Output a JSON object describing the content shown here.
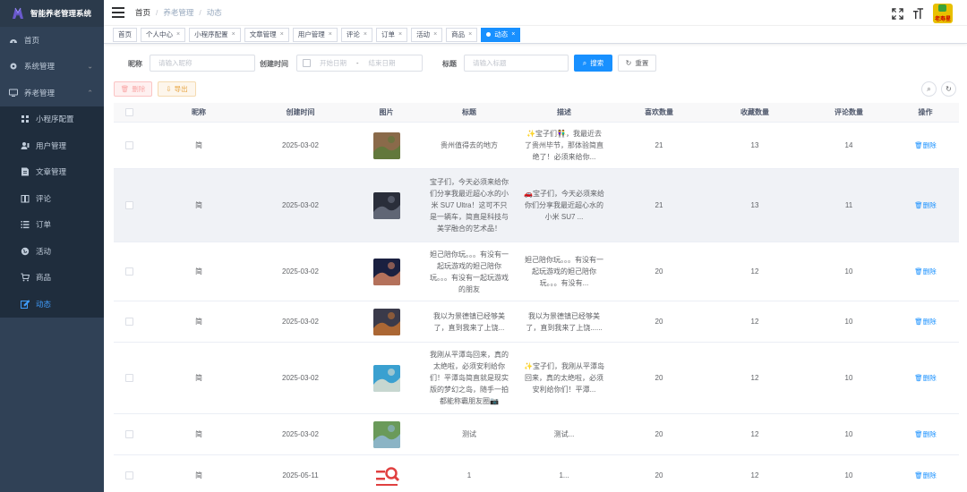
{
  "app": {
    "title": "智能养老管理系统"
  },
  "sidebar": {
    "items": [
      {
        "label": "首页",
        "icon": "dashboard-icon"
      },
      {
        "label": "系统管理",
        "icon": "gear-icon",
        "arrow": "⌄"
      },
      {
        "label": "养老管理",
        "icon": "monitor-icon",
        "arrow": "⌃"
      }
    ],
    "subitems": [
      {
        "label": "小程序配置",
        "icon": "grid-icon"
      },
      {
        "label": "用户管理",
        "icon": "user-icon"
      },
      {
        "label": "文章管理",
        "icon": "document-icon"
      },
      {
        "label": "评论",
        "icon": "book-icon"
      },
      {
        "label": "订单",
        "icon": "list-icon"
      },
      {
        "label": "活动",
        "icon": "globe-icon"
      },
      {
        "label": "商品",
        "icon": "cart-icon"
      },
      {
        "label": "动态",
        "icon": "edit-icon"
      }
    ]
  },
  "breadcrumb": {
    "home": "首页",
    "section": "养老管理",
    "current": "动态",
    "sep": "/"
  },
  "avatar_text": "老寿星",
  "tags": [
    {
      "label": "首页",
      "closable": false
    },
    {
      "label": "个人中心",
      "closable": true
    },
    {
      "label": "小程序配置",
      "closable": true
    },
    {
      "label": "文章管理",
      "closable": true
    },
    {
      "label": "用户管理",
      "closable": true
    },
    {
      "label": "评论",
      "closable": true
    },
    {
      "label": "订单",
      "closable": true
    },
    {
      "label": "活动",
      "closable": true
    },
    {
      "label": "商品",
      "closable": true
    },
    {
      "label": "动态",
      "closable": true,
      "active": true
    }
  ],
  "search": {
    "nickname_label": "昵称",
    "nickname_placeholder": "请输入昵称",
    "created_label": "创建时间",
    "start_placeholder": "开始日期",
    "range_sep": "-",
    "end_placeholder": "结束日期",
    "title_label": "标题",
    "title_placeholder": "请输入标题",
    "search_btn": "搜索",
    "reset_btn": "重置"
  },
  "toolbar": {
    "delete_btn": "删除",
    "export_btn": "导出"
  },
  "table": {
    "headers": {
      "name": "昵称",
      "date": "创建时间",
      "image": "图片",
      "title": "标题",
      "desc": "描述",
      "likes": "喜欢数量",
      "favs": "收藏数量",
      "comments": "评论数量",
      "op": "操作"
    },
    "op_label": "删除",
    "rows": [
      {
        "name": "简",
        "date": "2025-03-02",
        "title": "贵州值得去的地方",
        "desc": "✨宝子们👫，我最近去了贵州毕节，那体验简直绝了！必须来给你...",
        "likes": "21",
        "favs": "13",
        "comments": "14",
        "img_color": "#8a6a4a",
        "img_color2": "#5a7a3a"
      },
      {
        "name": "简",
        "date": "2025-03-02",
        "title": "宝子们，今天必须来给你们分享我最近超心水的小米 SU7 Ultra！这可不只是一辆车，简直是科技与美学融合的艺术品！",
        "desc": "🚗宝子们，今天必须来给你们分享我最近超心水的小米 SU7 ...",
        "likes": "21",
        "favs": "13",
        "comments": "11",
        "img_color": "#2a2e3a",
        "img_color2": "#6a7080"
      },
      {
        "name": "简",
        "date": "2025-03-02",
        "title": "妲己陪你玩。。。有没有一起玩游戏的妲己陪你玩。。。有没有一起玩游戏的朋友",
        "desc": "妲己陪你玩。。。有没有一起玩游戏的妲己陪你玩。。。有没有...",
        "likes": "20",
        "favs": "12",
        "comments": "10",
        "img_color": "#1a2040",
        "img_color2": "#d08060"
      },
      {
        "name": "简",
        "date": "2025-03-02",
        "title": "我以为景德镇已经够美了，直到我来了上饶...",
        "desc": "我以为景德镇已经够美了，直到我来了上饶......",
        "likes": "20",
        "favs": "12",
        "comments": "10",
        "img_color": "#3a3a4a",
        "img_color2": "#c07030"
      },
      {
        "name": "简",
        "date": "2025-03-02",
        "title": "我刚从平潭岛回来，真的太绝啦，必须安利给你们！平潭岛简直就是现实版的梦幻之岛，随手一拍都能称霸朋友圈📷",
        "desc": "✨宝子们，我刚从平潭岛回来，真的太绝啦，必须安利给你们！平潭...",
        "likes": "20",
        "favs": "12",
        "comments": "10",
        "img_color": "#3aa0d0",
        "img_color2": "#e0e0d0"
      },
      {
        "name": "简",
        "date": "2025-03-02",
        "title": "测试",
        "desc": "测试...",
        "likes": "20",
        "favs": "12",
        "comments": "10",
        "img_color": "#6a9a5a",
        "img_color2": "#90b8d8"
      },
      {
        "name": "简",
        "date": "2025-05-11",
        "title": "1",
        "desc": "1...",
        "likes": "20",
        "favs": "12",
        "comments": "10",
        "img_color": "#ffffff",
        "img_color2": "#e04040"
      }
    ]
  }
}
